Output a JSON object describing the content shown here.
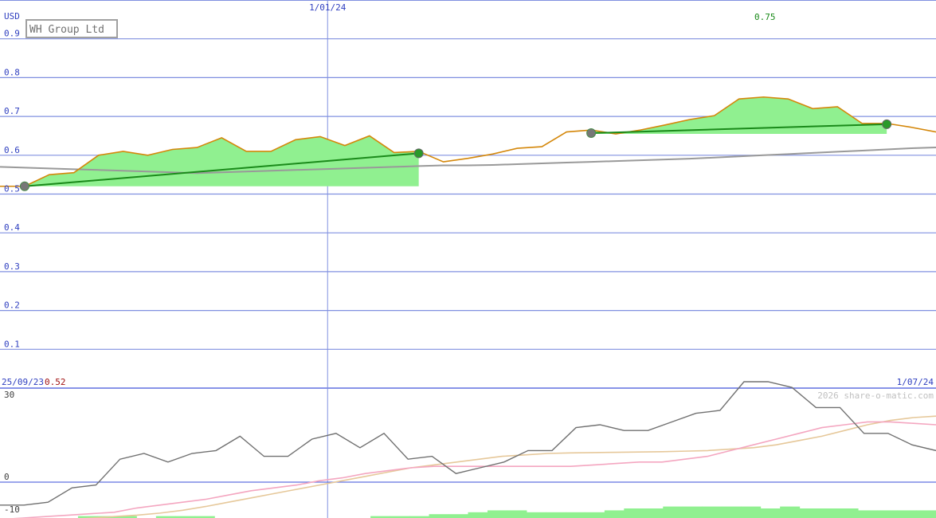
{
  "chart_data": [
    {
      "type": "line",
      "title": "WH Group Ltd",
      "ylabel": "USD",
      "ylim": [
        0,
        1.0
      ],
      "y_ticks": [
        "0.1",
        "0.2",
        "0.3",
        "0.4",
        "0.5",
        "0.6",
        "0.7",
        "0.8",
        "0.9"
      ],
      "x_range": [
        "2023-09-25",
        "2024-07-01"
      ],
      "x_labels": [
        {
          "date": "2024-01-01",
          "text": "1/01/24"
        }
      ],
      "start_label": "25/09/23",
      "start_value": "0.52",
      "end_label": "1/07/24",
      "peak_label": "0.75",
      "colors": {
        "price": "#d4870a",
        "trend": "#1a8a1a",
        "average": "#999999",
        "fill": "#90f090",
        "grid": "#8090e0"
      },
      "price": [
        0.52,
        0.52,
        0.55,
        0.555,
        0.6,
        0.61,
        0.6,
        0.615,
        0.62,
        0.645,
        0.61,
        0.61,
        0.64,
        0.648,
        0.625,
        0.65,
        0.607,
        0.61,
        0.583,
        0.592,
        0.603,
        0.618,
        0.622,
        0.66,
        0.665,
        0.655,
        0.665,
        0.678,
        0.692,
        0.702,
        0.745,
        0.75,
        0.745,
        0.72,
        0.725,
        0.682,
        0.682,
        0.672,
        0.66
      ],
      "average": [
        0.57,
        0.568,
        0.566,
        0.564,
        0.562,
        0.56,
        0.558,
        0.556,
        0.554,
        0.556,
        0.558,
        0.56,
        0.562,
        0.564,
        0.566,
        0.568,
        0.57,
        0.572,
        0.574,
        0.574,
        0.575,
        0.577,
        0.579,
        0.581,
        0.583,
        0.585,
        0.587,
        0.589,
        0.591,
        0.594,
        0.597,
        0.6,
        0.603,
        0.606,
        0.609,
        0.612,
        0.615,
        0.618,
        0.62
      ],
      "trends": [
        {
          "from_index": 1,
          "to_index": 17,
          "from_value": 0.52,
          "to_value": 0.605
        },
        {
          "from_index": 24,
          "to_index": 36,
          "from_value": 0.657,
          "to_value": 0.68
        }
      ]
    },
    {
      "type": "line",
      "ylim": [
        -10,
        30
      ],
      "y_ticks": [
        "30",
        "0",
        "-10"
      ],
      "watermark": "2026 share-o-matic.com",
      "colors": {
        "momentum": "#707070",
        "fast": "#f4a6c0",
        "slow": "#e6c89a",
        "volume": "#90f090"
      },
      "momentum": [
        -8,
        -8,
        -7,
        -2,
        -1,
        8,
        10,
        7,
        10,
        11,
        16,
        9,
        9,
        15,
        17,
        12,
        17,
        8,
        9,
        3,
        5,
        7,
        11,
        11,
        19,
        20,
        18,
        18,
        21,
        24,
        25,
        35,
        35,
        33,
        26,
        26,
        17,
        17,
        13,
        11
      ],
      "fast": [
        -13,
        -12.5,
        -12,
        -11.5,
        -11,
        -10.5,
        -9,
        -8,
        -7,
        -6,
        -4.5,
        -3,
        -2,
        -1,
        0.5,
        1.5,
        3,
        4,
        5,
        5.5,
        5.5,
        5.5,
        5.5,
        5.5,
        5.5,
        5.5,
        6,
        6.5,
        7,
        7,
        8,
        9,
        11,
        13,
        15,
        17,
        19,
        20,
        21,
        21,
        20.5,
        20
      ],
      "slow": [
        -14,
        -13.8,
        -13.5,
        -13,
        -12.5,
        -12,
        -11.5,
        -10.8,
        -9.8,
        -8.5,
        -7,
        -5.5,
        -4,
        -2.5,
        -1,
        0.5,
        2,
        3.5,
        5,
        6,
        7,
        8,
        9,
        9.5,
        10,
        10.2,
        10.3,
        10.4,
        10.5,
        10.6,
        10.8,
        11,
        11.5,
        12,
        13,
        14.5,
        16,
        18,
        20,
        21.5,
        22.5,
        23
      ],
      "volume": [
        0,
        0,
        0,
        0,
        1,
        1,
        1,
        0,
        1,
        1,
        1,
        0,
        0,
        0,
        0,
        0,
        0,
        0,
        0,
        1,
        1,
        1,
        2,
        2,
        3,
        4,
        4,
        3,
        3,
        3,
        3,
        4,
        5,
        5,
        6,
        6,
        6,
        6,
        6,
        5,
        6,
        5,
        5,
        5,
        4,
        4,
        4,
        4
      ]
    }
  ]
}
